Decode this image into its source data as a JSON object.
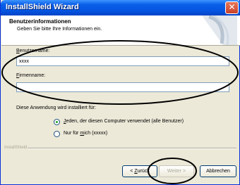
{
  "window": {
    "title": "InstallShield Wizard",
    "close_label": "✕"
  },
  "header": {
    "title": "Benutzerinformationen",
    "subtitle": "Geben Sie bitte Ihre Informationen ein."
  },
  "form": {
    "username_label_accel": "B",
    "username_label_rest": "enutzername:",
    "username_value": "xxxx",
    "company_label_accel": "F",
    "company_label_rest": "irmenname:",
    "company_value": ""
  },
  "install_for": {
    "label": "Diese Anwendung wird installiert für:",
    "options": [
      {
        "pre": "",
        "accel": "J",
        "post": "eden, der diesen Computer verwendet (alle Benutzer)",
        "checked": true
      },
      {
        "pre": "Nur für ",
        "accel": "m",
        "post": "ich (xxxxx)",
        "checked": false
      }
    ]
  },
  "footer": {
    "brand": "InstallShield",
    "back_pre": "< ",
    "back_accel": "Z",
    "back_post": "urück",
    "next_label": "Weiter >",
    "cancel_label": "Abbrechen"
  },
  "colors": {
    "titlebar": "#0454e0",
    "annotation": "#000000"
  }
}
